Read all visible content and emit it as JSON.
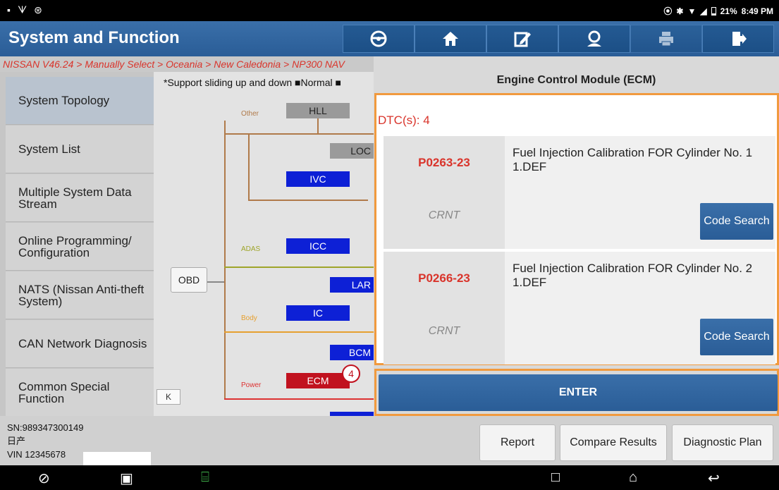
{
  "status_bar": {
    "time": "8:49 PM",
    "battery": "21%"
  },
  "header": {
    "title": "System and Function"
  },
  "breadcrumb": "NISSAN V46.24 > Manually Select > Oceania > New Caledonia > NP300 NAV",
  "sidebar": {
    "items": [
      {
        "label": "System Topology"
      },
      {
        "label": "System List"
      },
      {
        "label": "Multiple System Data Stream"
      },
      {
        "label": "Online Programming/ Configuration"
      },
      {
        "label": "NATS (Nissan Anti-theft System)"
      },
      {
        "label": "CAN Network Diagnosis"
      },
      {
        "label": "Common Special Function"
      }
    ]
  },
  "topology": {
    "legend": "*Support sliding up and down ■Normal ■",
    "groups": {
      "other": "Other",
      "adas": "ADAS",
      "body": "Body",
      "power": "Power"
    },
    "nodes": {
      "hll": "HLL",
      "loc": "LOC",
      "ivc": "IVC",
      "icc": "ICC",
      "lar": "LAR",
      "ic": "IC",
      "bcm": "BCM",
      "ecm": "ECM",
      "obd": "OBD"
    },
    "k_button": "K",
    "ecm_dtc_badge": "4"
  },
  "dialog": {
    "title": "Engine Control Module (ECM)",
    "dtc_count": "DTC(s): 4",
    "dtcs": [
      {
        "code": "P0263-23",
        "status": "CRNT",
        "description": "Fuel Injection Calibration FOR Cylinder No. 1 1.DEF",
        "search_label": "Code Search"
      },
      {
        "code": "P0266-23",
        "status": "CRNT",
        "description": "Fuel Injection Calibration FOR Cylinder No. 2 1.DEF",
        "search_label": "Code Search"
      }
    ],
    "enter_label": "ENTER"
  },
  "footer": {
    "sn": "SN:989347300149",
    "brand": "日产",
    "vin": "VIN 12345678",
    "buttons": {
      "report": "Report",
      "compare": "Compare Results",
      "plan": "Diagnostic Plan"
    }
  },
  "colors": {
    "header_blue": "#2a5d97",
    "dtc_red": "#d9342b",
    "highlight_orange": "#f19a3e"
  }
}
